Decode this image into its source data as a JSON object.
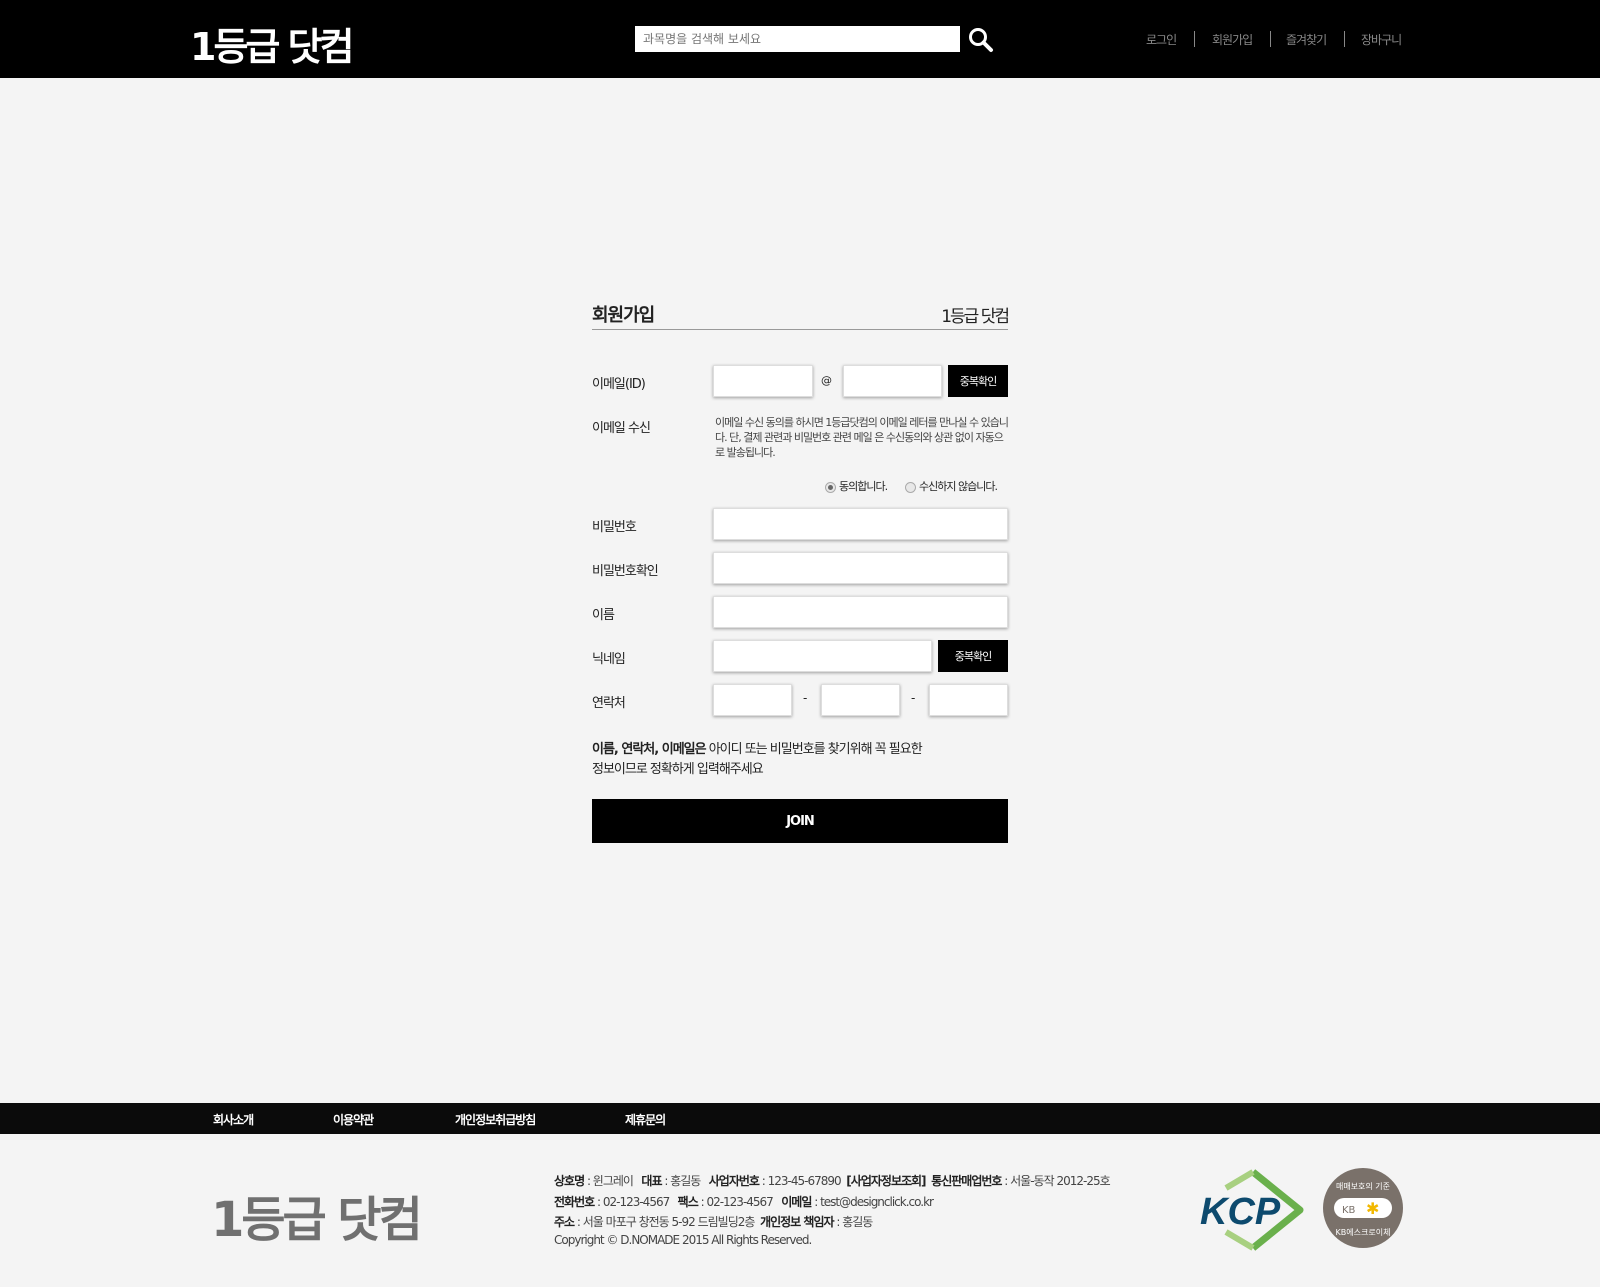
{
  "header": {
    "logo": "1등급 닷컴",
    "search_placeholder": "과목명을 검색해 보세요",
    "nav": [
      "로그인",
      "회원가입",
      "즐겨찾기",
      "장바구니"
    ]
  },
  "form": {
    "title": "회원가입",
    "brand": "1등급 닷컴",
    "email_label": "이메일(ID)",
    "at": "@",
    "check_button": "중복확인",
    "email_recv_label": "이메일 수신",
    "email_recv_text": "이메일 수신 동의를 하시면  1등급닷컴의 이메일 레터를 만나실 수 있습니다. 단, 결제 관련과 비밀번호 관련 메일 은 수신동의와 상관 없이 자동으로 발송됩니다.",
    "agree": "동의합니다.",
    "disagree": "수신하지 않습니다.",
    "agree_selected": true,
    "password_label": "비밀번호",
    "password_confirm_label": "비밀번호확인",
    "name_label": "이름",
    "nickname_label": "닉네임",
    "nickname_check_button": "중복확인",
    "phone_label": "연락처",
    "dash": "-",
    "note_bold": "이름, 연락처, 이메일은",
    "note_rest": " 아이디 또는 비밀번호를 찾기위해 꼭 필요한",
    "note_line2": "정보이므로 정확하게 입력해주세요",
    "join": "JOIN"
  },
  "footer": {
    "nav": [
      "회사소개",
      "이용약관",
      "개인정보취급방침",
      "제휴문의"
    ],
    "logo": "1등급 닷컴",
    "company_k": "상호명",
    "company_v": " : 윈그레이",
    "ceo_k": "대표",
    "ceo_v": " : 홍길동",
    "bizno_k": "사업자번호",
    "bizno_v": " : 123-45-67890",
    "bizinfo": "[사업자정보조회]",
    "mail_order_k": "통신판매업번호",
    "mail_order_v": " : 서울-동작 2012-25호",
    "tel_k": "전화번호",
    "tel_v": " : 02-123-4567",
    "fax_k": "팩스",
    "fax_v": " : 02-123-4567",
    "email_k": "이메일",
    "email_v": " : test@designclick.co.kr",
    "addr_k": "주소",
    "addr_v": " : 서울 마포구 창전동 5-92 드림빌딩2층",
    "privacy_k": "개인정보 책임자",
    "privacy_v": " : 홍길동",
    "copyright": "Copyright © D.NOMADE 2015 All Rights Reserved.",
    "kcp": "KCP",
    "seal_top": "매매보호의 기준",
    "seal_kb": "KB",
    "seal_bottom": "KB에스크로이체"
  },
  "colors": {
    "header_bg": "#000000",
    "page_bg": "#f4f4f4",
    "kcp_blue": "#0d4a6e",
    "kcp_green": "#6ab04c",
    "seal": "#7a716a"
  }
}
